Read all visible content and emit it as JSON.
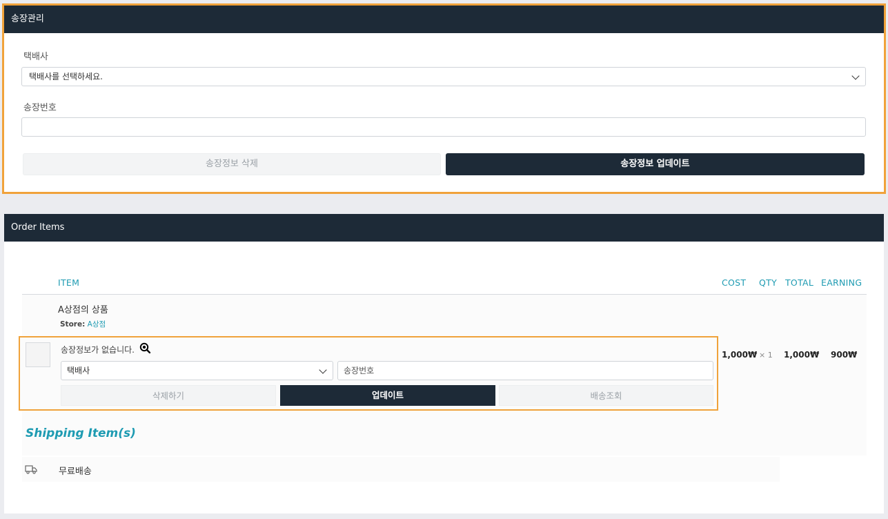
{
  "invoice_panel": {
    "title": "송장관리",
    "carrier_label": "택배사",
    "carrier_selected": "택배사를 선택하세요.",
    "tracking_label": "송장번호",
    "tracking_value": "",
    "delete_button": "송장정보 삭제",
    "update_button": "송장정보 업데이트"
  },
  "order_panel": {
    "title": "Order Items",
    "columns": {
      "item": "ITEM",
      "cost": "COST",
      "qty": "QTY",
      "total": "TOTAL",
      "earning": "EARNING"
    },
    "item": {
      "name": "A상점의 상품",
      "store_label": "Store:",
      "store_name": "A상점",
      "no_invoice_text": "송장정보가 없습니다.",
      "carrier_selected": "택배사",
      "tracking_placeholder": "송장번호",
      "delete_button": "삭제하기",
      "update_button": "업데이트",
      "track_button": "배송조회",
      "cost": "1,000₩",
      "qty": "× 1",
      "total": "1,000₩",
      "earning": "900₩"
    },
    "shipping_title": "Shipping Item(s)",
    "shipping_item": "무료배송"
  },
  "colors": {
    "accent": "#1e9bb2",
    "dark": "#1d2a37",
    "highlight": "#f0a23a"
  },
  "icons": [
    "chevron-down-icon",
    "magnifier-icon",
    "truck-icon"
  ]
}
